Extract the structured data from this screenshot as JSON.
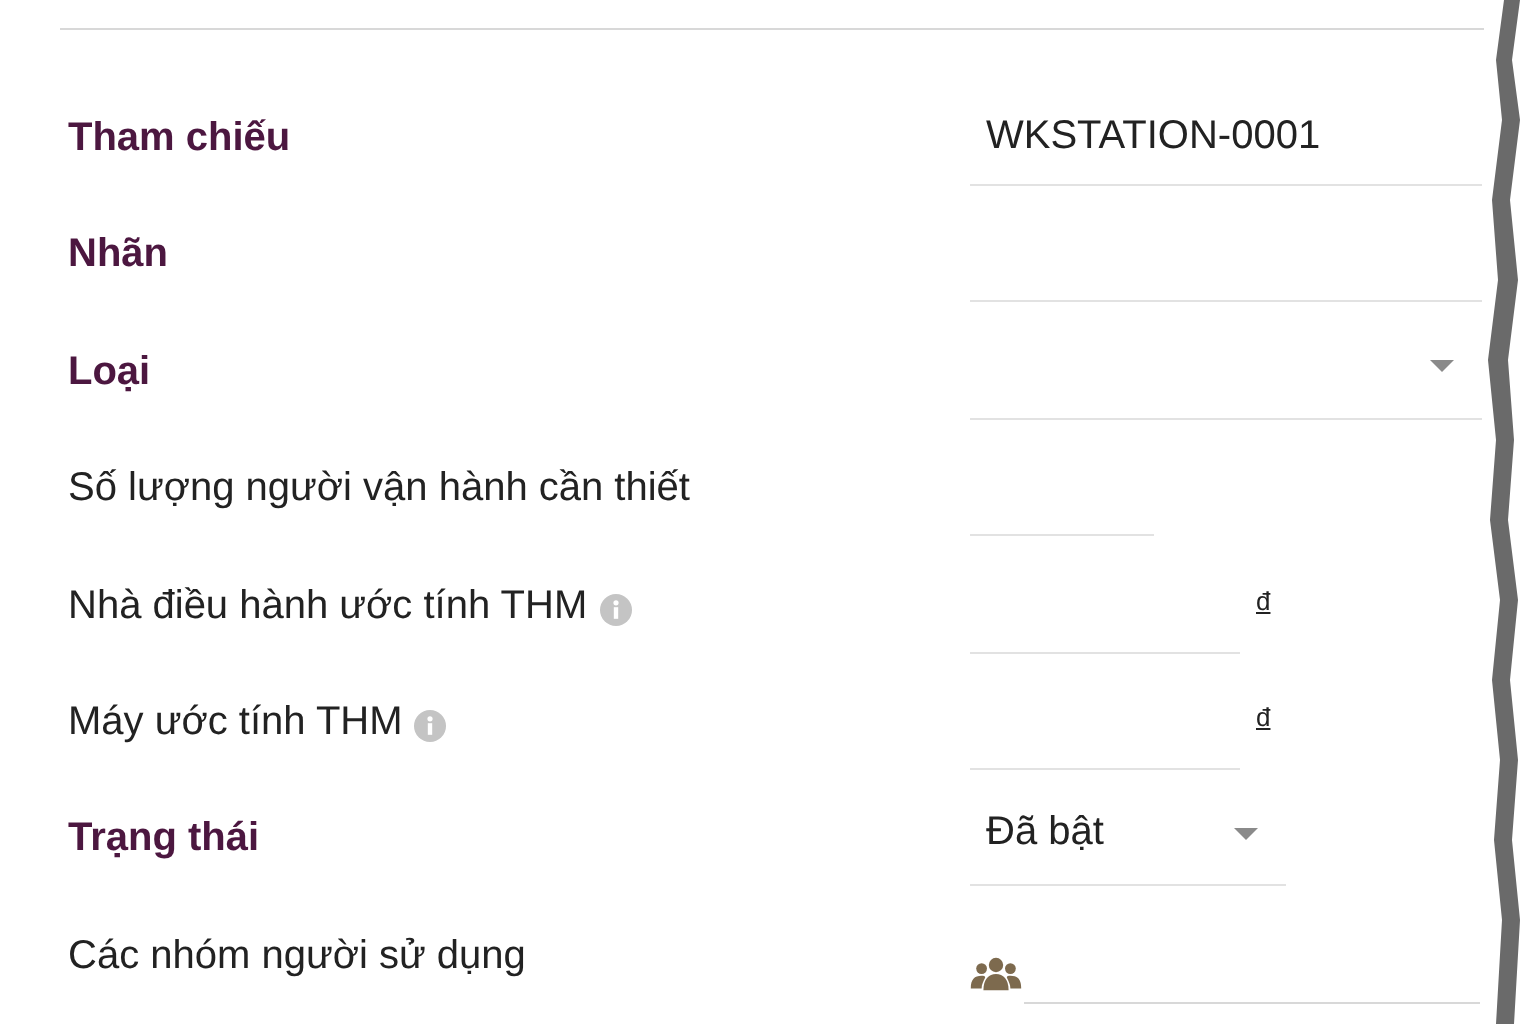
{
  "fields": [
    {
      "label": "Tham chiếu",
      "required": true,
      "kind": "text",
      "value": "WKSTATION-0001"
    },
    {
      "label": "Nhãn",
      "required": true,
      "kind": "text"
    },
    {
      "label": "Loại",
      "required": true,
      "kind": "select"
    },
    {
      "label": "Số lượng người vận hành cần thiết",
      "required": false,
      "kind": "number"
    },
    {
      "label": "Nhà điều hành ước tính THM",
      "required": false,
      "info": true,
      "kind": "currency",
      "currency": "đ"
    },
    {
      "label": "Máy ước tính THM",
      "required": false,
      "info": true,
      "kind": "currency",
      "currency": "đ"
    },
    {
      "label": "Trạng thái",
      "required": true,
      "kind": "status",
      "value": "Đã bật"
    },
    {
      "label": "Các nhóm người sử dụng",
      "required": false,
      "kind": "users"
    }
  ]
}
